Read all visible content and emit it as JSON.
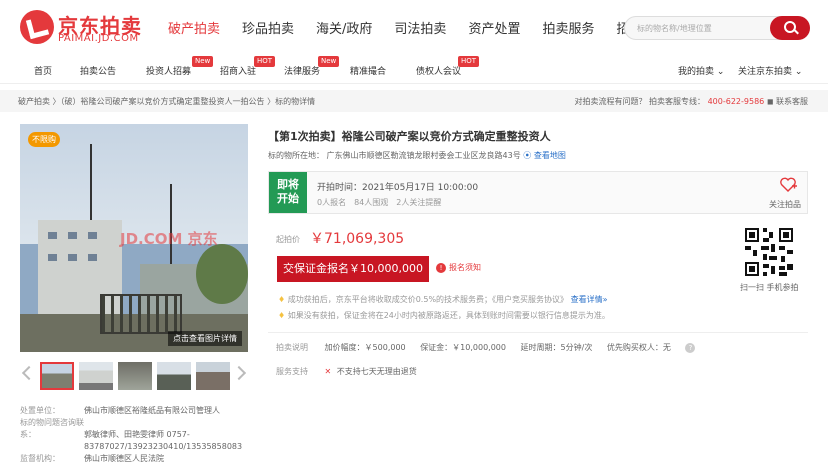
{
  "logo": {
    "title": "京东拍卖",
    "subtitle": "PAIMAI.JD.COM"
  },
  "main_nav": [
    "破产拍卖",
    "珍品拍卖",
    "海关/政府",
    "司法拍卖",
    "资产处置",
    "拍卖服务",
    "招标采购"
  ],
  "search": {
    "placeholder": "标的物名称/地理位置"
  },
  "sub_nav": {
    "home": "首页",
    "announce": "拍卖公告",
    "investor": "投资人招募",
    "settle": "招商入驻",
    "legal": "法律服务",
    "match": "精准撮合",
    "creditor": "债权人会议",
    "my": "我的拍卖",
    "focus": "关注京东拍卖",
    "badge_new": "New",
    "badge_hot": "HOT"
  },
  "breadcrumb": "破产拍卖 〉（破）裕隆公司破产案以竞价方式确定重整投资人一拍公告 〉标的物详情",
  "help": {
    "question": "对拍卖流程有问题？",
    "hotline_label": "拍卖客服专线：",
    "hotline": "400-622-9586",
    "contact": "联系客服"
  },
  "photo": {
    "tag": "不限购",
    "watermark": "JD.COM 京东",
    "link": "点击查看图片详情"
  },
  "info": {
    "disposer_label": "处置单位：",
    "disposer": "佛山市顺德区裕隆纸品有限公司管理人",
    "consult_label": "标的物问题咨询联系：",
    "consult_1": "郭敏律师、田艳雯律师 0757-",
    "consult_2": "83787027/13923230410/13535858083",
    "supervisor_label": "监督机构：",
    "supervisor": "佛山市顺德区人民法院"
  },
  "item": {
    "title": "【第1次拍卖】裕隆公司破产案以竞价方式确定重整投资人",
    "address_label": "标的物所在地：",
    "address": "广东佛山市顺德区勒流镇龙眼村委会工业区龙良路43号",
    "map_link": "查看地图"
  },
  "status": {
    "flag_1": "即将",
    "flag_2": "开始",
    "start_time": "开拍时间：2021年05月17日 10:00:00",
    "counts": "0人报名　84人围观　2人关注提醒",
    "follow": "关注拍品"
  },
  "price": {
    "label": "起拍价",
    "value": "￥71,069,305"
  },
  "deposit_button": "交保证金报名￥10,000,000",
  "notice": "报名须知",
  "tips": {
    "t1": "成功获拍后，京东平台将收取成交价0.5%的技术服务费；《用户竞买服务协议》",
    "t1_link": "查看详情»",
    "t2": "如果没有获拍，保证金将在24小时内被原路返还，具体到账时间需要以银行信息提示为准。"
  },
  "qr": {
    "caption": "扫一扫 手机参拍"
  },
  "terms": {
    "label": "拍卖说明",
    "increment": "加价幅度：￥500,000",
    "deposit": "保证金：￥10,000,000",
    "delay": "延时周期：5分钟/次",
    "priority": "优先购买权人：无"
  },
  "service": {
    "label": "服务支持",
    "no_return": "不支持七天无理由退货"
  }
}
